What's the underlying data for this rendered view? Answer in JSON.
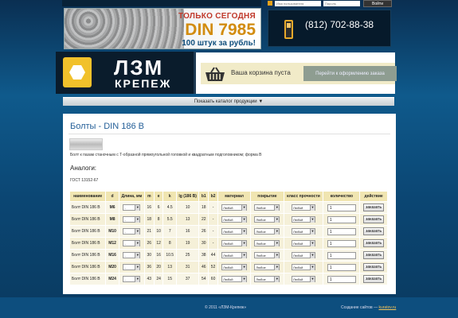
{
  "header": {
    "login": {
      "username_placeholder": "Имя пользователя",
      "password_placeholder": "Пароль",
      "enter_label": "Войти"
    },
    "promo": {
      "line1": "ТОЛЬКО СЕГОДНЯ",
      "line2": "DIN 7985",
      "line3": "100 штук за рубль!"
    },
    "phone": "(812) 702-88-38",
    "logo": {
      "line1": "ЛЗМ",
      "line2": "КРЕПЕЖ"
    }
  },
  "cart": {
    "status": "Ваша корзина пуста",
    "order_button": "Перейти к оформлению заказа"
  },
  "catalog_toggle": "Показать каталог продукции",
  "product": {
    "title": "Болты - DIN 186 B",
    "description": "Болт к пазам станочным с Т-образной прямоугольной головкой и квадратным подголовником; форма B",
    "analogs_heading": "Аналоги:",
    "gost": "ГОСТ 13152-67"
  },
  "table": {
    "headers": [
      "наименование",
      "d",
      "Длина, мм",
      "m",
      "e",
      "k",
      "lg (186 B)",
      "b1",
      "b2",
      "материал",
      "покрытие",
      "класс прочности",
      "количество",
      "действие"
    ],
    "rows": [
      {
        "name": "Болт DIN 186 B",
        "d": "M6",
        "len": "-",
        "m": "16",
        "e": "6",
        "k": "4.5",
        "lg": "10",
        "b1": "18",
        "b2": "-",
        "mat": "Любой",
        "cov": "Любое",
        "cls": "Любой",
        "qty": "1",
        "action": "заказать"
      },
      {
        "name": "Болт DIN 186 B",
        "d": "M8",
        "len": "-",
        "m": "18",
        "e": "8",
        "k": "5.5",
        "lg": "13",
        "b1": "22",
        "b2": "-",
        "mat": "Любой",
        "cov": "Любое",
        "cls": "Любой",
        "qty": "1",
        "action": "заказать"
      },
      {
        "name": "Болт DIN 186 B",
        "d": "M10",
        "len": "-",
        "m": "21",
        "e": "10",
        "k": "7",
        "lg": "16",
        "b1": "26",
        "b2": "-",
        "mat": "Любой",
        "cov": "Любое",
        "cls": "Любой",
        "qty": "1",
        "action": "заказать"
      },
      {
        "name": "Болт DIN 186 B",
        "d": "M12",
        "len": "-",
        "m": "26",
        "e": "12",
        "k": "8",
        "lg": "19",
        "b1": "30",
        "b2": "-",
        "mat": "Любой",
        "cov": "Любое",
        "cls": "Любой",
        "qty": "1",
        "action": "заказать"
      },
      {
        "name": "Болт DIN 186 B",
        "d": "M16",
        "len": "-",
        "m": "30",
        "e": "16",
        "k": "10.5",
        "lg": "25",
        "b1": "38",
        "b2": "44",
        "mat": "Любой",
        "cov": "Любое",
        "cls": "Любой",
        "qty": "1",
        "action": "заказать"
      },
      {
        "name": "Болт DIN 186 B",
        "d": "M20",
        "len": "-",
        "m": "36",
        "e": "20",
        "k": "13",
        "lg": "31",
        "b1": "46",
        "b2": "52",
        "mat": "Любой",
        "cov": "Любое",
        "cls": "Любой",
        "qty": "1",
        "action": "заказать"
      },
      {
        "name": "Болт DIN 186 B",
        "d": "M24",
        "len": "-",
        "m": "43",
        "e": "24",
        "k": "15",
        "lg": "37",
        "b1": "54",
        "b2": "60",
        "mat": "Любой",
        "cov": "Любое",
        "cls": "Любой",
        "qty": "1",
        "action": "заказать"
      }
    ]
  },
  "footer": {
    "copyright": "© 2011 «ЛЗМ-Крепеж»",
    "credit_text": "Создание сайтов —",
    "credit_link": "kuratov.ru"
  }
}
